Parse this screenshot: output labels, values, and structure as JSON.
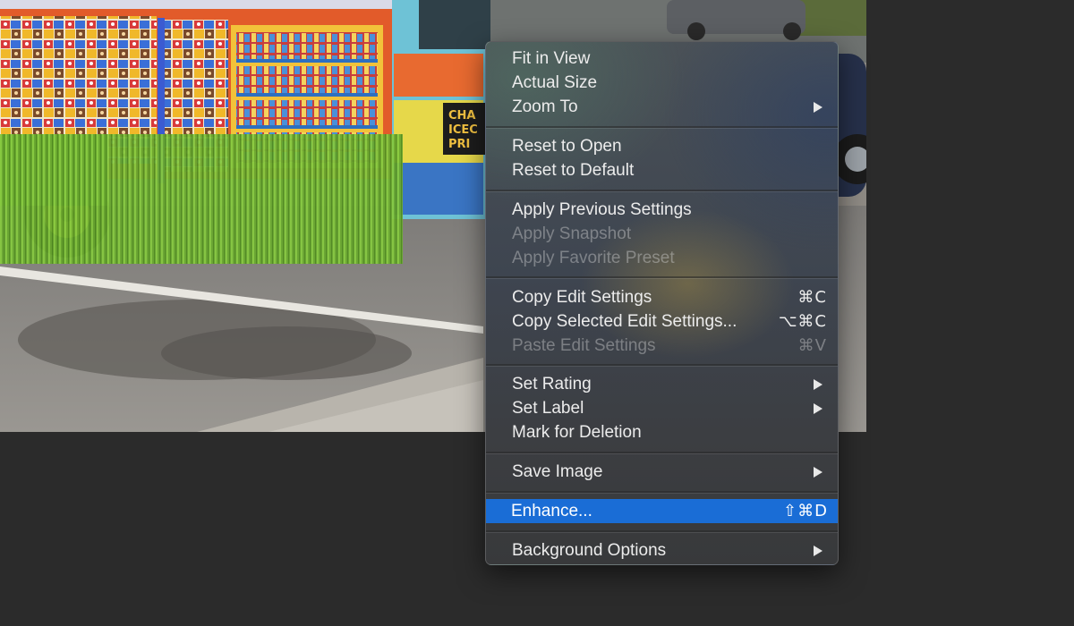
{
  "colors": {
    "menu_highlight": "#1a6dd6",
    "workspace_background": "#2b2b2b"
  },
  "photo": {
    "van_sign_text": [
      "CHA",
      "ICEC",
      "PRI"
    ]
  },
  "context_menu": {
    "items": [
      {
        "label": "Fit in View",
        "shortcut": "",
        "submenu": false,
        "enabled": true,
        "highlighted": false
      },
      {
        "label": "Actual Size",
        "shortcut": "",
        "submenu": false,
        "enabled": true,
        "highlighted": false
      },
      {
        "label": "Zoom To",
        "shortcut": "",
        "submenu": true,
        "enabled": true,
        "highlighted": false
      },
      {
        "label": "Reset to Open",
        "shortcut": "",
        "submenu": false,
        "enabled": true,
        "highlighted": false
      },
      {
        "label": "Reset to Default",
        "shortcut": "",
        "submenu": false,
        "enabled": true,
        "highlighted": false
      },
      {
        "label": "Apply Previous Settings",
        "shortcut": "",
        "submenu": false,
        "enabled": true,
        "highlighted": false
      },
      {
        "label": "Apply Snapshot",
        "shortcut": "",
        "submenu": false,
        "enabled": false,
        "highlighted": false
      },
      {
        "label": "Apply Favorite Preset",
        "shortcut": "",
        "submenu": false,
        "enabled": false,
        "highlighted": false
      },
      {
        "label": "Copy Edit Settings",
        "shortcut": "⌘C",
        "submenu": false,
        "enabled": true,
        "highlighted": false
      },
      {
        "label": "Copy Selected Edit Settings...",
        "shortcut": "⌥⌘C",
        "submenu": false,
        "enabled": true,
        "highlighted": false
      },
      {
        "label": "Paste Edit Settings",
        "shortcut": "⌘V",
        "submenu": false,
        "enabled": false,
        "highlighted": false
      },
      {
        "label": "Set Rating",
        "shortcut": "",
        "submenu": true,
        "enabled": true,
        "highlighted": false
      },
      {
        "label": "Set Label",
        "shortcut": "",
        "submenu": true,
        "enabled": true,
        "highlighted": false
      },
      {
        "label": "Mark for Deletion",
        "shortcut": "",
        "submenu": false,
        "enabled": true,
        "highlighted": false
      },
      {
        "label": "Save Image",
        "shortcut": "",
        "submenu": true,
        "enabled": true,
        "highlighted": false
      },
      {
        "label": "Enhance...",
        "shortcut": "⇧⌘D",
        "submenu": false,
        "enabled": true,
        "highlighted": true
      },
      {
        "label": "Background Options",
        "shortcut": "",
        "submenu": true,
        "enabled": true,
        "highlighted": false
      }
    ]
  }
}
